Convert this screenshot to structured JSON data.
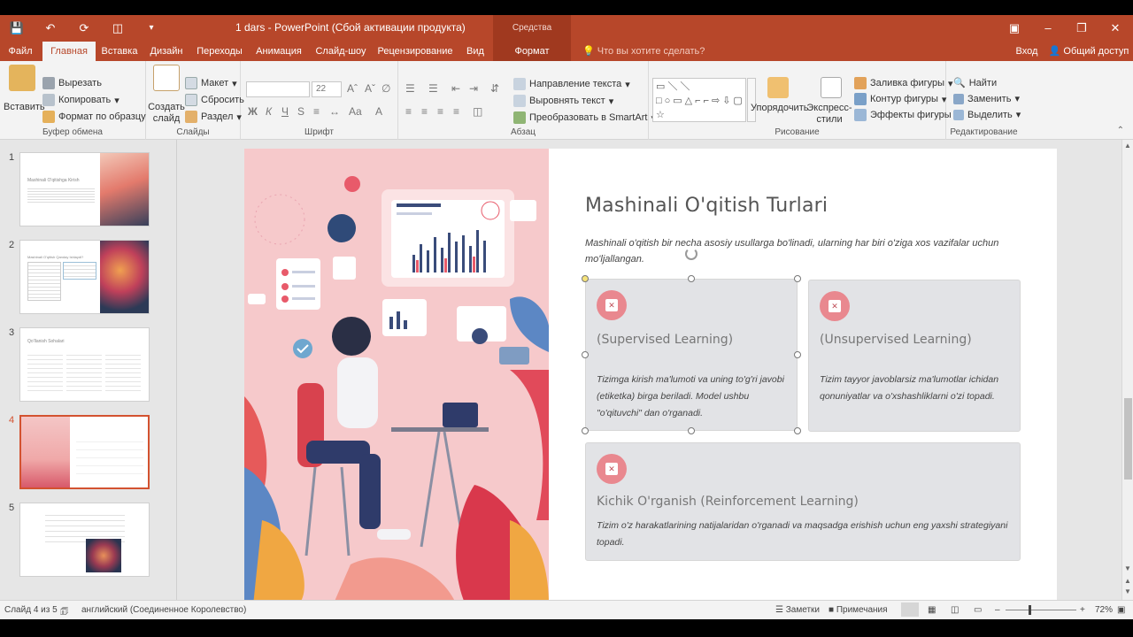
{
  "window": {
    "doc_title": "1 dars - PowerPoint (Сбой активации продукта)",
    "context_group": "Средства рисования",
    "sign_in": "Вход",
    "share": "Общий доступ"
  },
  "tabs": [
    "Файл",
    "Главная",
    "Вставка",
    "Дизайн",
    "Переходы",
    "Анимация",
    "Слайд-шоу",
    "Рецензирование",
    "Вид",
    "Формат"
  ],
  "tellme": "Что вы хотите сделать?",
  "ribbon": {
    "clipboard": {
      "label": "Буфер обмена",
      "paste": "Вставить",
      "cut": "Вырезать",
      "copy": "Копировать",
      "format_painter": "Формат по образцу"
    },
    "slides": {
      "label": "Слайды",
      "new_slide": "Создать слайд",
      "layout": "Макет",
      "reset": "Сбросить",
      "section": "Раздел"
    },
    "font": {
      "label": "Шрифт",
      "size": "22",
      "bold": "Ж",
      "italic": "К",
      "underline": "Ч",
      "shadow": "S"
    },
    "paragraph": {
      "label": "Абзац",
      "text_direction": "Направление текста",
      "align_text": "Выровнять текст",
      "smartart": "Преобразовать в SmartArt"
    },
    "drawing": {
      "label": "Рисование",
      "arrange": "Упорядочить",
      "quick_styles": "Экспресс-стили",
      "fill": "Заливка фигуры",
      "outline": "Контур фигуры",
      "effects": "Эффекты фигуры"
    },
    "editing": {
      "label": "Редактирование",
      "find": "Найти",
      "replace": "Заменить",
      "select": "Выделить"
    }
  },
  "thumbnails": [
    {
      "num": "1",
      "title": "Mashinali O'qitishga Kirish"
    },
    {
      "num": "2",
      "title": "Mashinali O'qitish Qanday Ishlaydi?"
    },
    {
      "num": "3",
      "title": "Qo'llanish Sohalari"
    },
    {
      "num": "4",
      "title": ""
    },
    {
      "num": "5",
      "title": ""
    }
  ],
  "slide": {
    "title": "Mashinali O'qitish Turlari",
    "intro": "Mashinali o'qitish bir necha asosiy usullarga bo'linadi, ularning har biri o'ziga xos vazifalar uchun mo'ljallangan.",
    "cards": [
      {
        "title": "(Supervised Learning)",
        "text": "Tizimga kirish ma'lumoti va uning to'g'ri javobi (etiketka) birga beriladi. Model ushbu \"o'qituvchi\" dan o'rganadi."
      },
      {
        "title": "(Unsupervised Learning)",
        "text": "Tizim tayyor javoblarsiz ma'lumotlar ichidan qonuniyatlar va o'xshashliklarni o'zi topadi."
      },
      {
        "title": "Kichik O'rganish (Reinforcement Learning)",
        "text": "Tizim o'z harakatlarining natijalaridan o'rganadi va maqsadga erishish uchun eng yaxshi strategiyani topadi."
      }
    ]
  },
  "status": {
    "slide_of": "Слайд 4 из 5",
    "language": "английский (Соединенное Королевство)",
    "notes": "Заметки",
    "comments": "Примечания",
    "zoom": "72%"
  },
  "colors": {
    "accent": "#b7472a",
    "card_bg": "#e2e3e6",
    "icon_pink": "#e9888f"
  }
}
